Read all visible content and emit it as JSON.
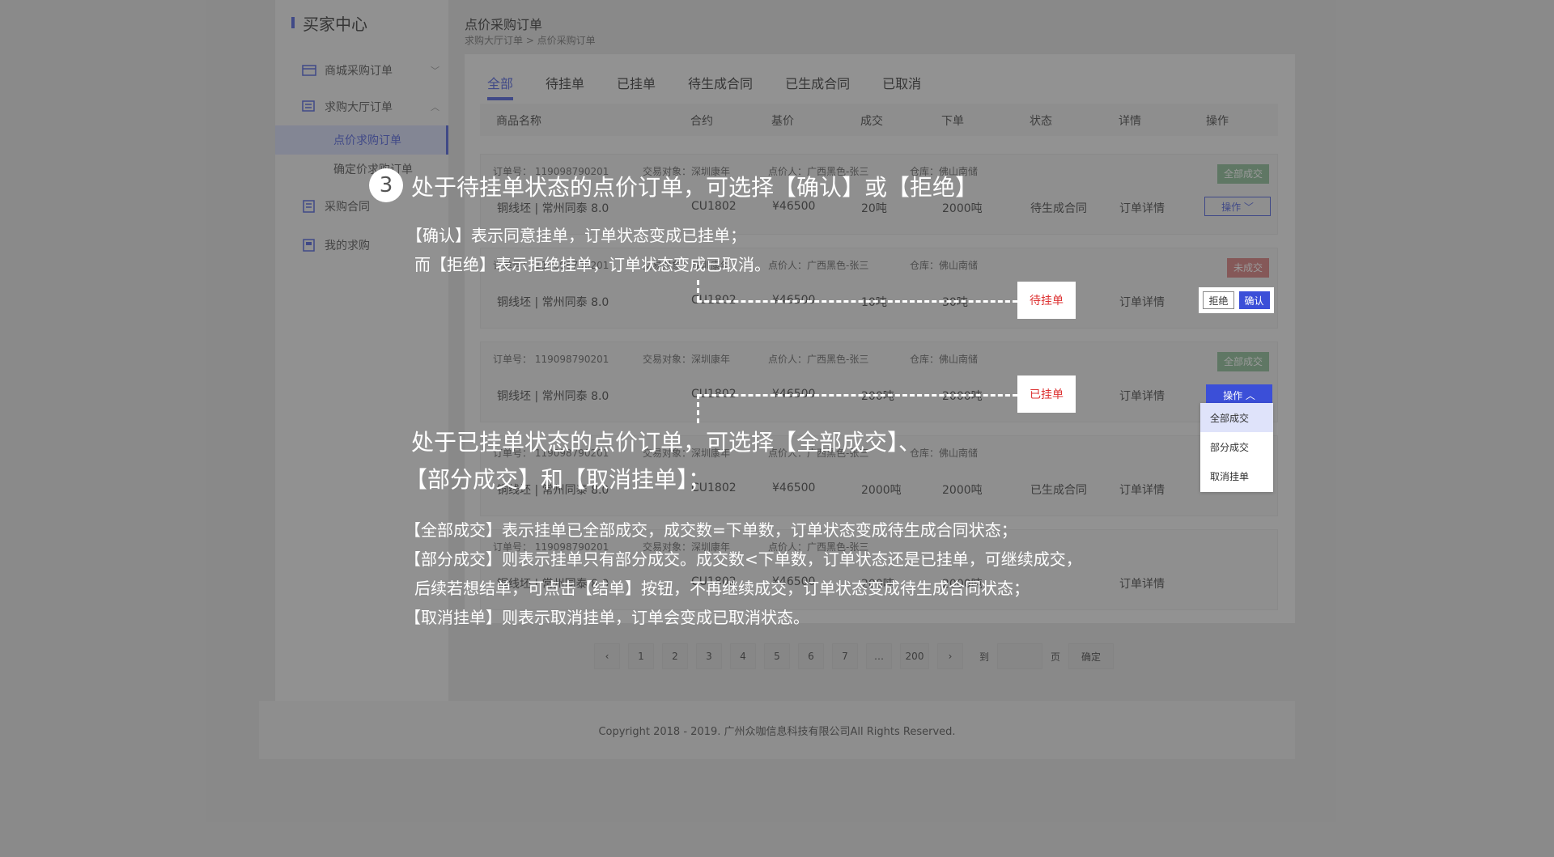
{
  "sidebar": {
    "brand": "买家中心",
    "items": [
      {
        "label": "商城采购订单",
        "icon": "store-icon",
        "chev": "﹀"
      },
      {
        "label": "求购大厅订单",
        "icon": "list-icon",
        "chev": "︿"
      },
      {
        "label": "采购合同",
        "icon": "contract-icon"
      },
      {
        "label": "我的求购",
        "icon": "doc-icon"
      }
    ],
    "sub_items": [
      {
        "label": "点价求购订单"
      },
      {
        "label": "确定价求购订单"
      }
    ]
  },
  "header": {
    "title": "点价采购订单",
    "breadcrumb": "求购大厅订单 > 点价采购订单"
  },
  "tabs": [
    "全部",
    "待挂单",
    "已挂单",
    "待生成合同",
    "已生成合同",
    "已取消"
  ],
  "table": {
    "columns": [
      "商品名称",
      "合约",
      "基价",
      "成交",
      "下单",
      "状态",
      "详情",
      "操作"
    ],
    "meta_labels": {
      "order_no": "订单号： 119098790201",
      "counterparty": "交易对象：深圳康年",
      "pricer": "点价人：广西黑色-张三",
      "warehouse": "仓库：佛山南储"
    },
    "rows": [
      {
        "product": "铜线坯 | 常州同泰 8.0",
        "contract": "CU1802",
        "price": "¥46500",
        "deal": "20吨",
        "order": "2000吨",
        "status": "待生成合同",
        "detail": "订单详情",
        "badge": "全部成交",
        "op": "操作 ﹀"
      },
      {
        "product": "铜线坯 | 常州同泰 8.0",
        "contract": "CU1802",
        "price": "¥46500",
        "deal": "10吨",
        "order": "30吨",
        "status": "待挂单",
        "detail": "订单详情",
        "badge": "未成交",
        "reject": "拒绝",
        "confirm": "确认"
      },
      {
        "product": "铜线坯 | 常州同泰 8.0",
        "contract": "CU1802",
        "price": "¥46500",
        "deal": "200吨",
        "order": "2000吨",
        "status": "已挂单",
        "detail": "订单详情",
        "badge": "全部成交",
        "op": "操作 ︿"
      },
      {
        "product": "铜线坯 | 常州同泰 8.0",
        "contract": "CU1802",
        "price": "¥46500",
        "deal": "2000吨",
        "order": "2000吨",
        "status": "已生成合同",
        "detail": "订单详情"
      },
      {
        "product": "铜线坯 | 常州同泰 8.0",
        "contract": "CU1802",
        "price": "¥46500",
        "deal": "200吨",
        "order": "2000吨",
        "status": "",
        "detail": "订单详情"
      }
    ]
  },
  "dropdown": [
    "全部成交",
    "部分成交",
    "取消挂单"
  ],
  "pagination": {
    "prev": "‹",
    "pages": [
      "1",
      "2",
      "3",
      "4",
      "5",
      "6",
      "7",
      "…",
      "200"
    ],
    "next": "›",
    "goto_label": "到",
    "page_label": "页",
    "confirm": "确定"
  },
  "footer": "Copyright 2018 - 2019. 广州众咖信息科技有限公司All Rights Reserved.",
  "annotations": {
    "step_number": "3",
    "heading1": "处于待挂单状态的点价订单，可选择【确认】或【拒绝】",
    "note1_line1": "【确认】表示同意挂单，订单状态变成已挂单；",
    "note1_line2": "而【拒绝】表示拒绝挂单，订单状态变成已取消。",
    "heading2_line1": "处于已挂单状态的点价订单，可选择【全部成交】、",
    "heading2_line2": "【部分成交】和【取消挂单】；",
    "note2_line1": "【全部成交】表示挂单已全部成交，成交数=下单数，订单状态变成待生成合同状态；",
    "note2_line2": "【部分成交】则表示挂单只有部分成交。成交数<下单数，订单状态还是已挂单，可继续成交，",
    "note2_line3": "后续若想结单，可点击【结单】按钮，不再继续成交，订单状态变成待生成合同状态；",
    "note2_line4": "【取消挂单】则表示取消挂单，订单会变成已取消状态。"
  },
  "colors": {
    "accent": "#3b4fd8",
    "status_red": "#d33",
    "status_green": "#4a9a5a",
    "badge_green": "#7fb48a",
    "badge_red": "#d36f6f"
  }
}
